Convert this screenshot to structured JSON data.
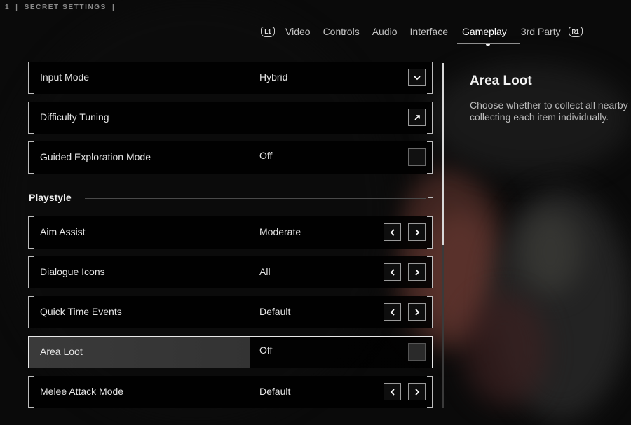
{
  "breadcrumb": {
    "page_number": "1",
    "separator": "|",
    "title": "SECRET SETTINGS"
  },
  "nav": {
    "left_button": "L1",
    "right_button": "R1",
    "tabs": [
      {
        "label": "Video",
        "active": false
      },
      {
        "label": "Controls",
        "active": false
      },
      {
        "label": "Audio",
        "active": false
      },
      {
        "label": "Interface",
        "active": false
      },
      {
        "label": "Gameplay",
        "active": true
      },
      {
        "label": "3rd Party",
        "active": false
      }
    ]
  },
  "settings": {
    "input_mode": {
      "label": "Input Mode",
      "value": "Hybrid",
      "control": "chevron-down-icon"
    },
    "difficulty": {
      "label": "Difficulty Tuning",
      "control": "external-link-icon"
    },
    "guided": {
      "label": "Guided Exploration Mode",
      "value": "Off",
      "control": "checkbox"
    },
    "section_title": "Playstyle",
    "aim_assist": {
      "label": "Aim Assist",
      "value": "Moderate"
    },
    "dialogue_icons": {
      "label": "Dialogue Icons",
      "value": "All"
    },
    "qte": {
      "label": "Quick Time Events",
      "value": "Default"
    },
    "area_loot": {
      "label": "Area Loot",
      "value": "Off",
      "selected": true
    },
    "melee": {
      "label": "Melee Attack Mode",
      "value": "Default"
    }
  },
  "description": {
    "title": "Area Loot",
    "line1": "Choose whether to collect all nearby",
    "line2": "collecting each item individually."
  },
  "colors": {
    "background": "#0a0a0a",
    "text": "#e6e6e6",
    "border": "#bdbdbd"
  }
}
